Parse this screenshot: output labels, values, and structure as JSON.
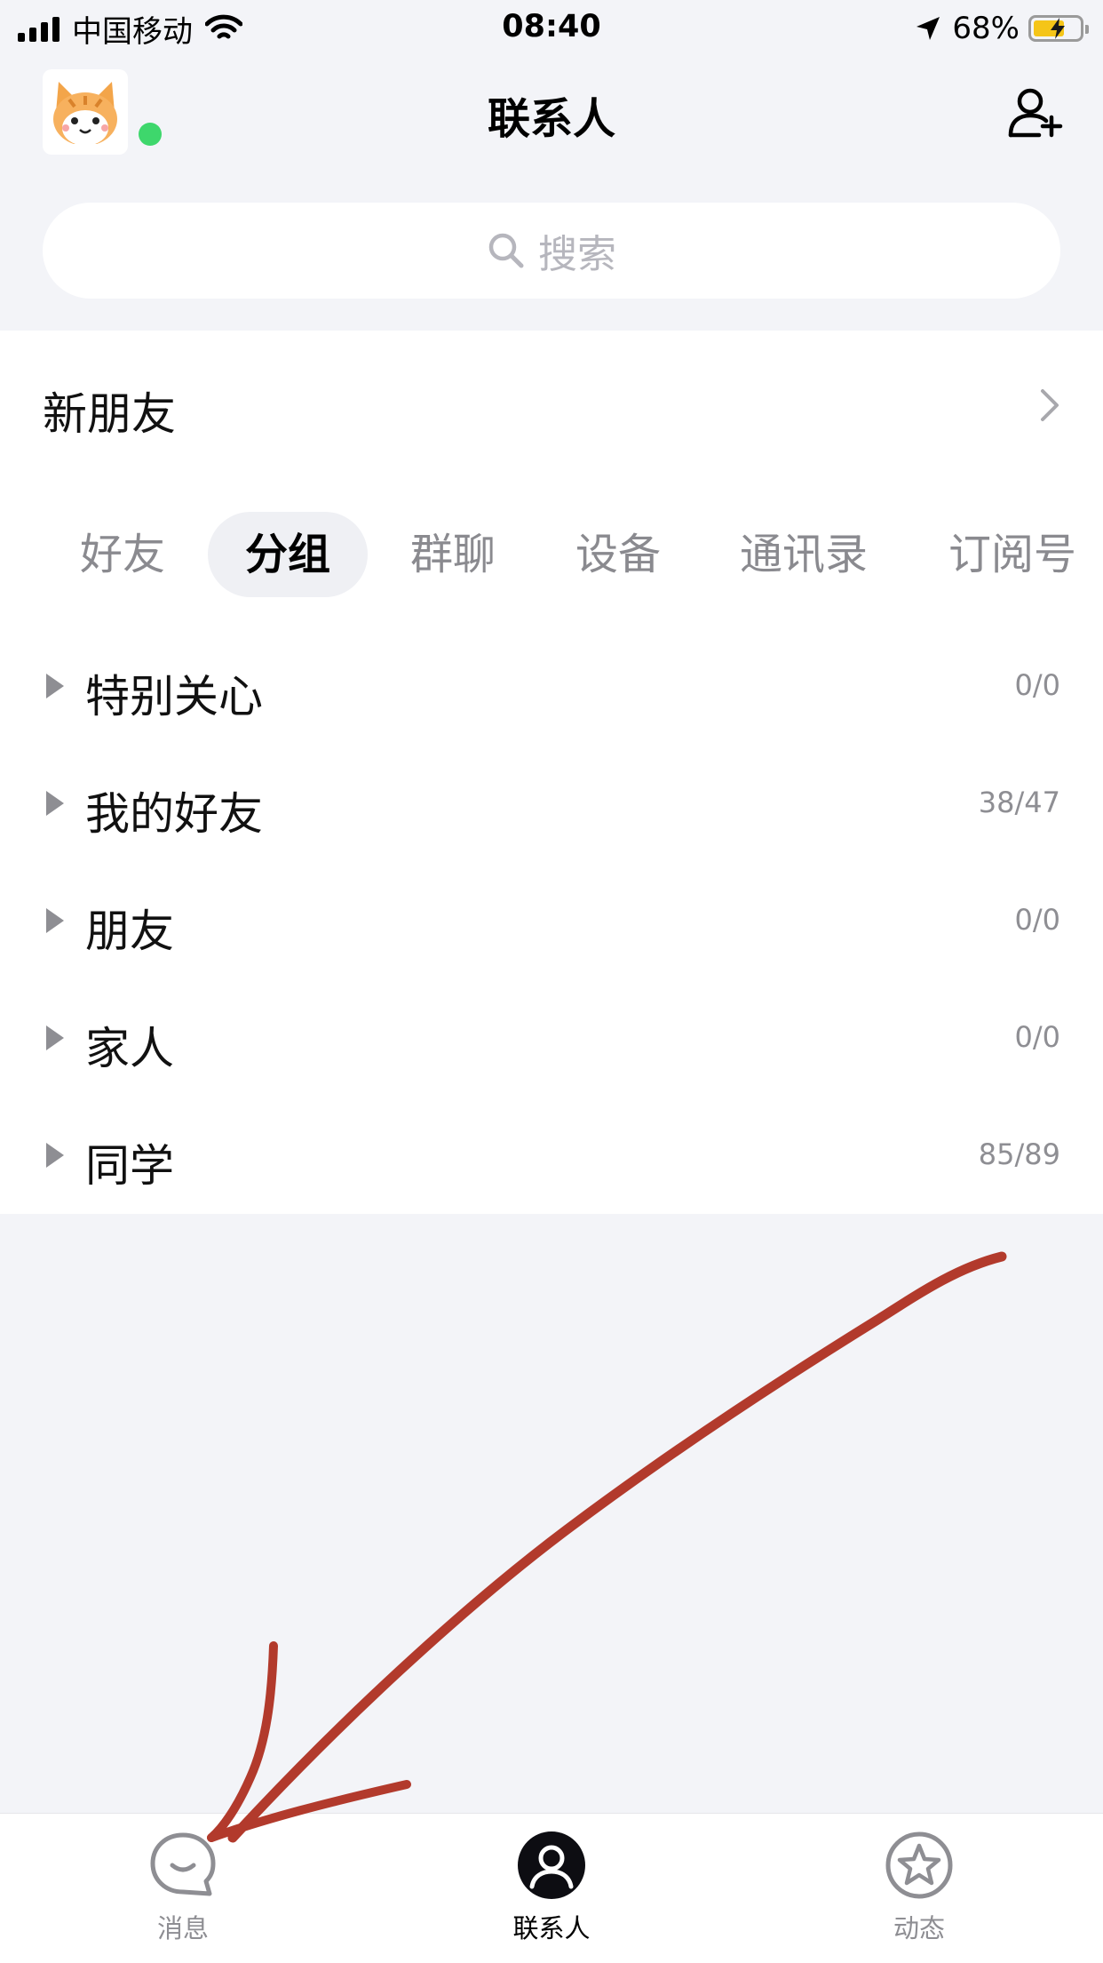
{
  "status_bar": {
    "carrier": "中国移动",
    "time": "08:40",
    "battery": "68%",
    "battery_level": 0.68
  },
  "header": {
    "title": "联系人",
    "avatar_icon": "cat-avatar-icon",
    "add_icon": "add-contact-icon"
  },
  "search": {
    "placeholder": "搜索"
  },
  "new_friends": {
    "label": "新朋友"
  },
  "tabs": [
    {
      "label": "好友",
      "active": false
    },
    {
      "label": "分组",
      "active": true
    },
    {
      "label": "群聊",
      "active": false
    },
    {
      "label": "设备",
      "active": false
    },
    {
      "label": "通讯录",
      "active": false
    },
    {
      "label": "订阅号",
      "active": false
    }
  ],
  "groups": [
    {
      "name": "特别关心",
      "count": "0/0"
    },
    {
      "name": "我的好友",
      "count": "38/47"
    },
    {
      "name": "朋友",
      "count": "0/0"
    },
    {
      "name": "家人",
      "count": "0/0"
    },
    {
      "name": "同学",
      "count": "85/89"
    }
  ],
  "tab_bar": [
    {
      "label": "消息",
      "icon": "chat-bubble-icon",
      "active": false
    },
    {
      "label": "联系人",
      "icon": "contacts-icon",
      "active": true
    },
    {
      "label": "动态",
      "icon": "star-circle-icon",
      "active": false
    }
  ],
  "colors": {
    "annotation_arrow": "#b23a2c",
    "online": "#3ed76c",
    "background": "#f3f4f8"
  }
}
